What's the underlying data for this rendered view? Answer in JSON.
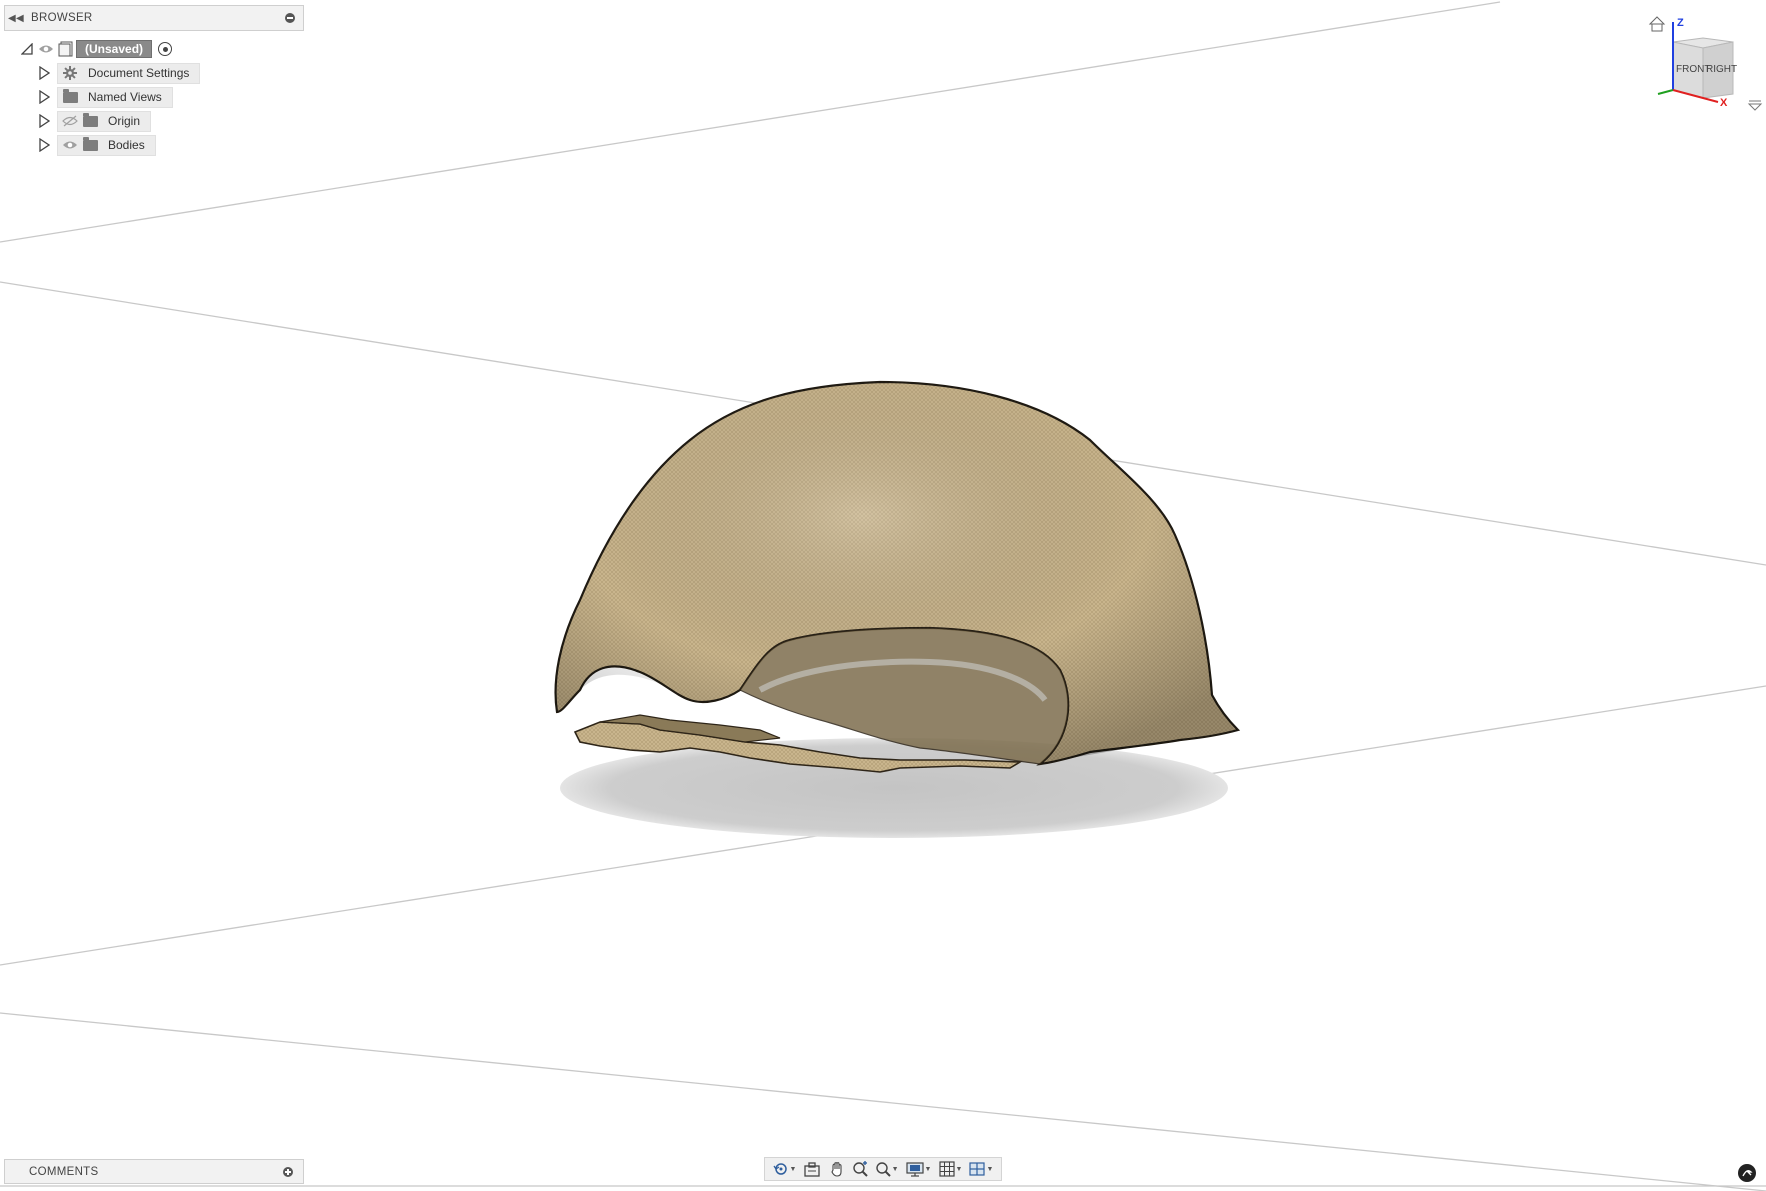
{
  "browser": {
    "title": "BROWSER",
    "collapse_icon": "double-left-arrow-icon",
    "pin_icon": "minus-circle-icon",
    "root": {
      "label": "(Unsaved)",
      "icon": "document-icon"
    },
    "items": [
      {
        "label": "Document Settings",
        "icon": "gear-icon",
        "has_visibility": false
      },
      {
        "label": "Named Views",
        "icon": "folder-icon",
        "has_visibility": false
      },
      {
        "label": "Origin",
        "icon": "folder-icon",
        "has_visibility": true,
        "visible": false
      },
      {
        "label": "Bodies",
        "icon": "folder-icon",
        "has_visibility": true,
        "visible": true
      }
    ]
  },
  "comments": {
    "title": "COMMENTS",
    "add_icon": "plus-circle-icon"
  },
  "viewcube": {
    "front_label": "FRONT",
    "right_label": "RIGHT",
    "z_label": "Z",
    "x_label": "X",
    "axis_colors": {
      "x": "#e02020",
      "y": "#20a020",
      "z": "#2040e0"
    }
  },
  "nav_toolbar": {
    "tools": [
      "orbit-icon",
      "look-at-icon",
      "pan-icon",
      "zoom-icon",
      "fit-icon",
      "display-settings-icon",
      "grid-icon",
      "viewports-icon"
    ]
  },
  "model": {
    "fill_color": "#c8b48c",
    "shadow_color": "#c9c9c9"
  }
}
